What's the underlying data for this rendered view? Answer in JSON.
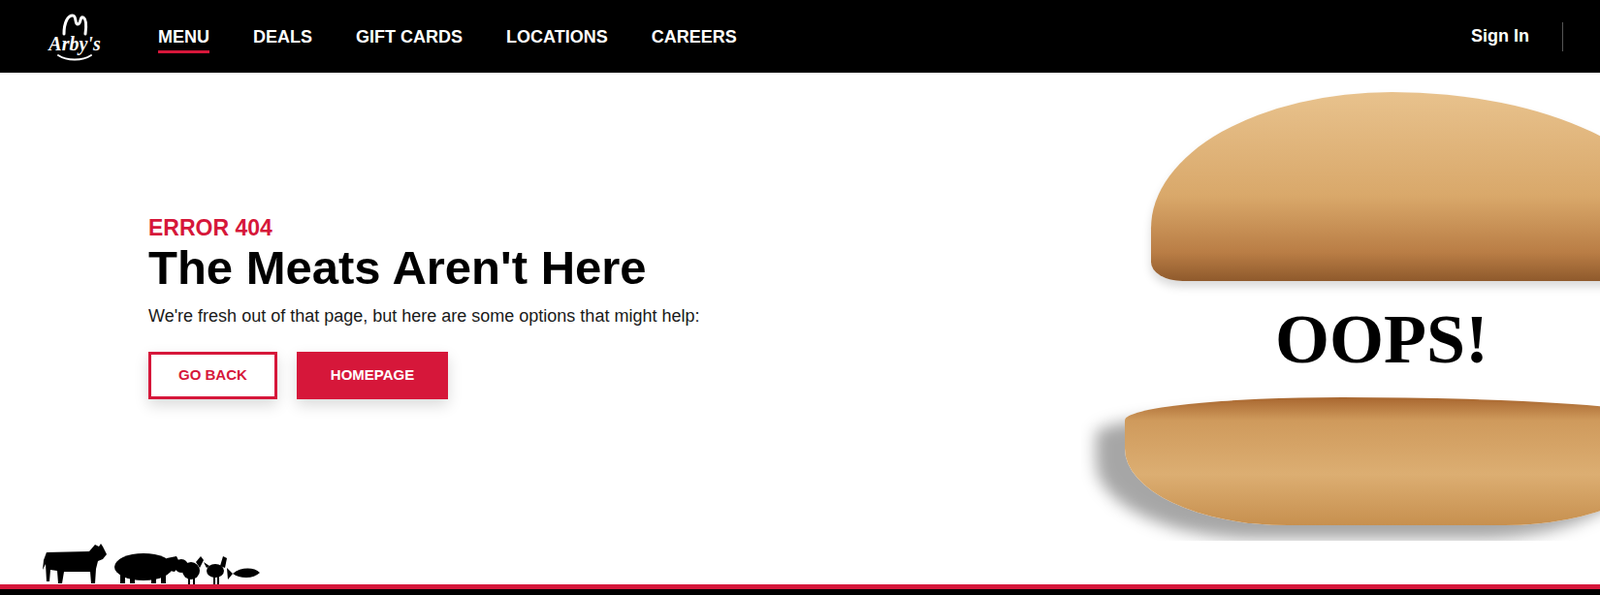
{
  "header": {
    "logo": "Arby's",
    "nav": [
      {
        "label": "MENU",
        "selected": true
      },
      {
        "label": "DEALS",
        "selected": false
      },
      {
        "label": "GIFT CARDS",
        "selected": false
      },
      {
        "label": "LOCATIONS",
        "selected": false
      },
      {
        "label": "CAREERS",
        "selected": false
      }
    ],
    "sign_in": "Sign In"
  },
  "error": {
    "code": "ERROR 404",
    "title": "The Meats Aren't Here",
    "message": "We're fresh out of that page, but here are some options that might help:",
    "buttons": [
      {
        "label": "GO BACK",
        "kind": "outline"
      },
      {
        "label": "HOMEPAGE",
        "kind": "filled"
      }
    ]
  },
  "graphic": {
    "text": "OOPS!"
  }
}
